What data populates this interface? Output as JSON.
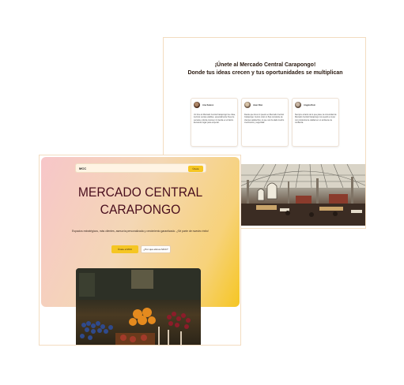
{
  "back_page": {
    "heading_line1": "¡Únete al Mercado Central Carapongo!",
    "heading_line2": "Donde tus ideas crecen y tus oportunidades se multiplican",
    "testimonials": [
      {
        "name": "Ana Suárez",
        "text": "Un lince al Mercado Central Carapongo fue clave, tuvimos ventas estables, especialmente fines de semana y ahora conocen mi tienda en el barrio. Excelente lugar para empezar."
      },
      {
        "name": "Juan Díaz",
        "text": "Desde que llevo mi puesto en Mercado Central Carapongo, hemos visto un flujo constante de clientes satisfechos, lo que nos ha dado mucho crecimiento y seguridad."
      },
      {
        "name": "Angela Ruiz",
        "text": "Siempre al tanto de lo que pasa, la comunidad de Mercado Central Carapongo nos ayudó a crecer con productos de calidad en un ambiente de confianza."
      }
    ],
    "photo_alt": "market-hall-photo"
  },
  "front_page": {
    "nav_logo": "MCC",
    "nav_button": "Únete",
    "title_line1": "MERCADO CENTRAL",
    "title_line2": "CARAPONGO",
    "subtitle": "Espacios estratégicos, más clientes, asesoría personalizada y crecimiento garantizado. ¿Sé parte de nuestro éxito!",
    "cta_primary": "Únete a MCC",
    "cta_secondary": "¿Por qué elimos MCC?",
    "photo_alt": "produce-stall-photo"
  },
  "colors": {
    "accent": "#f5c623",
    "title": "#4a0f1e",
    "hero_from": "#f7c6c9",
    "hero_to": "#f5c623"
  }
}
